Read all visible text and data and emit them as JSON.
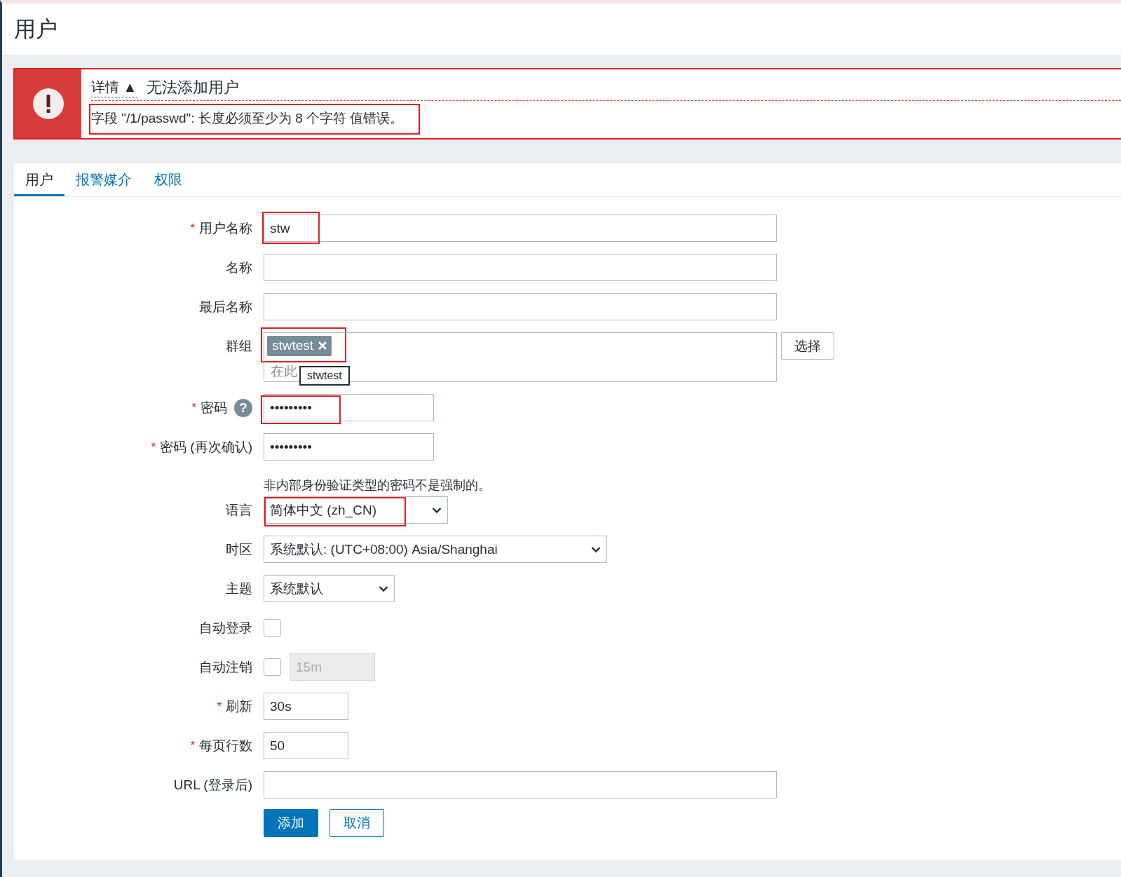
{
  "page_title": "用户",
  "error": {
    "details_label": "详情",
    "arrow": "▲",
    "title": "无法添加用户",
    "message": "字段 \"/1/passwd\": 长度必须至少为 8 个字符 值错误。",
    "highlighted": true
  },
  "tabs": [
    {
      "label": "用户",
      "selected": true
    },
    {
      "label": "报警媒介",
      "selected": false
    },
    {
      "label": "权限",
      "selected": false
    }
  ],
  "form": [
    {
      "kind": "text",
      "label": "用户名称",
      "required_mark": "*",
      "value": "stw",
      "highlighted": true
    },
    {
      "kind": "text",
      "label": "名称"
    },
    {
      "kind": "text",
      "label": "最后名称"
    },
    {
      "kind": "group",
      "label": "群组",
      "chips": [
        "stwtest"
      ],
      "placeholder": "在此",
      "tooltip": "stwtest",
      "button": "选择",
      "highlighted": true
    },
    {
      "kind": "password",
      "label": "密码",
      "required_mark": "*",
      "value": "•••••••••",
      "help": "?",
      "highlighted": true
    },
    {
      "kind": "password",
      "label": "密码 (再次确认)",
      "required_mark": "*",
      "value": "•••••••••"
    },
    {
      "kind": "note",
      "text": "非内部身份验证类型的密码不是强制的。"
    },
    {
      "kind": "select",
      "label": "语言",
      "value": "简体中文 (zh_CN)",
      "highlighted": true
    },
    {
      "kind": "select",
      "label": "时区",
      "value": "系统默认: (UTC+08:00) Asia/Shanghai"
    },
    {
      "kind": "select",
      "label": "主题",
      "value": "系统默认"
    },
    {
      "kind": "checkbox",
      "label": "自动登录",
      "checked": false
    },
    {
      "kind": "checkbox",
      "label": "自动注销",
      "checked": false,
      "value": "15m",
      "disabled": true
    },
    {
      "kind": "short",
      "label": "刷新",
      "required_mark": "*",
      "value": "30s"
    },
    {
      "kind": "short",
      "label": "每页行数",
      "required_mark": "*",
      "value": "50"
    },
    {
      "kind": "text",
      "label": "URL (登录后)"
    }
  ],
  "buttons": [
    {
      "label": "添加",
      "kind": "primary"
    },
    {
      "label": "取消",
      "kind": "secondary"
    }
  ]
}
